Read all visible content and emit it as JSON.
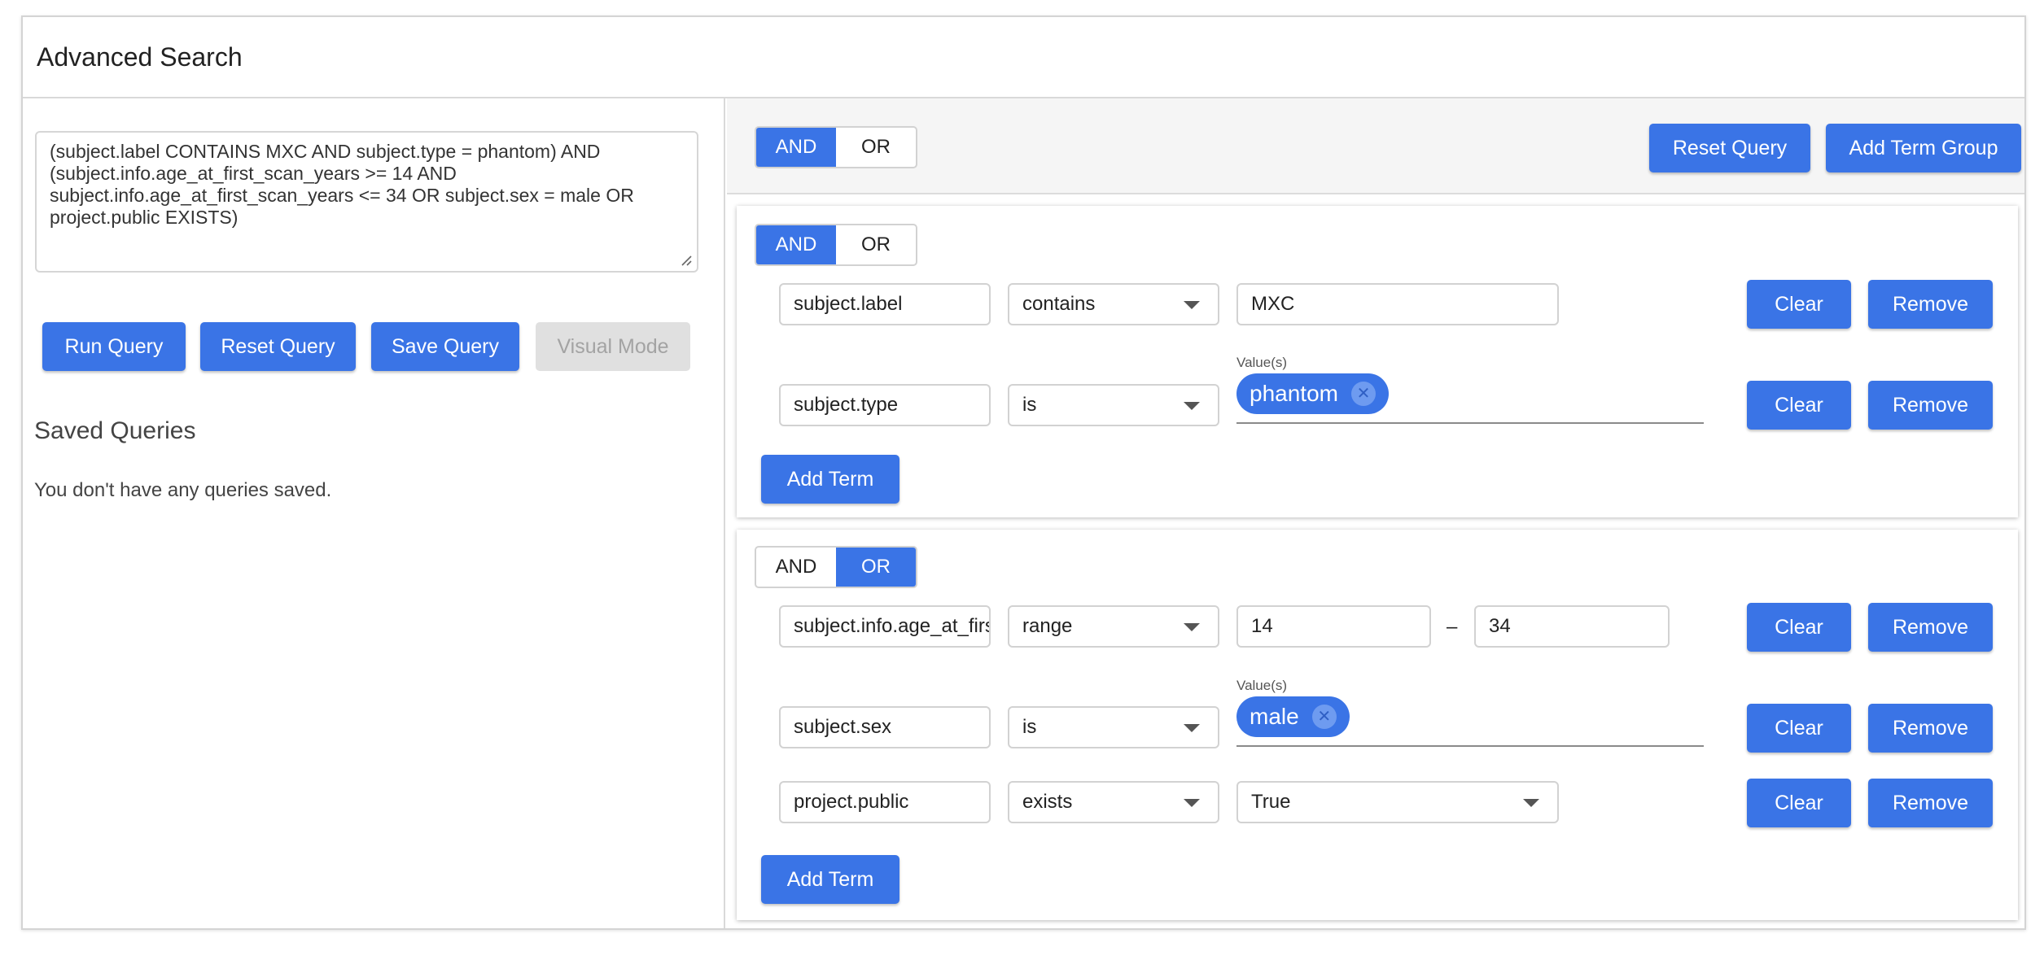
{
  "header": {
    "title": "Advanced Search"
  },
  "query": {
    "text": "(subject.label CONTAINS MXC AND subject.type = phantom) AND (subject.info.age_at_first_scan_years >= 14 AND subject.info.age_at_first_scan_years <= 34 OR subject.sex = male OR project.public EXISTS)"
  },
  "actions": {
    "run": "Run Query",
    "reset": "Reset Query",
    "save": "Save Query",
    "visual": "Visual Mode"
  },
  "saved": {
    "title": "Saved Queries",
    "empty": "You don't have any queries saved."
  },
  "builder": {
    "and_label": "AND",
    "or_label": "OR",
    "reset_label": "Reset Query",
    "add_group_label": "Add Term Group",
    "clear_label": "Clear",
    "remove_label": "Remove",
    "add_term_label": "Add Term",
    "values_label": "Value(s)",
    "range_dash": "–"
  },
  "groups": [
    {
      "operator": "AND",
      "terms": [
        {
          "field": "subject.label",
          "op": "contains",
          "value": "MXC"
        },
        {
          "field": "subject.type",
          "op": "is",
          "chips": [
            "phantom"
          ]
        }
      ]
    },
    {
      "operator": "OR",
      "terms": [
        {
          "field": "subject.info.age_at_first_scan_years",
          "op": "range",
          "min": "14",
          "max": "34"
        },
        {
          "field": "subject.sex",
          "op": "is",
          "chips": [
            "male"
          ]
        },
        {
          "field": "project.public",
          "op": "exists",
          "value": "True"
        }
      ]
    }
  ]
}
